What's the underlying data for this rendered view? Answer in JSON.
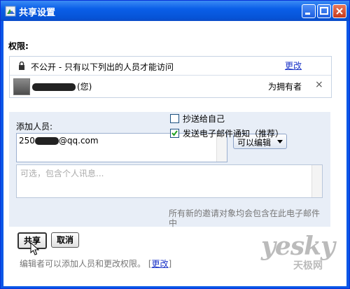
{
  "window": {
    "title": "共享设置",
    "icon": "share-settings-icon"
  },
  "permissions": {
    "label": "权限:",
    "access_text": "不公开 - 只有以下列出的人员才能访问",
    "change_link": "更改",
    "owner": {
      "name_suffix": "(您)",
      "role": "为拥有者",
      "remove_symbol": "×"
    }
  },
  "add_people": {
    "label": "添加人员:",
    "email_prefix": "250",
    "email_suffix": "@qq.com",
    "permission_select": "可以编辑",
    "message_placeholder": "可选，包含个人讯息...",
    "cc_self_label": "抄送给自己",
    "cc_self_checked": false,
    "notify_label": "发送电子邮件通知（推荐）",
    "notify_checked": true,
    "notify_note": "所有新的邀请对象均会包含在此电子邮件中"
  },
  "buttons": {
    "share": "共享",
    "cancel": "取消"
  },
  "footer": {
    "note": "编辑者可以添加人员和更改权限。",
    "link": "更改"
  },
  "watermark": {
    "logo": "yesky",
    "logo_sub": "天极网"
  }
}
